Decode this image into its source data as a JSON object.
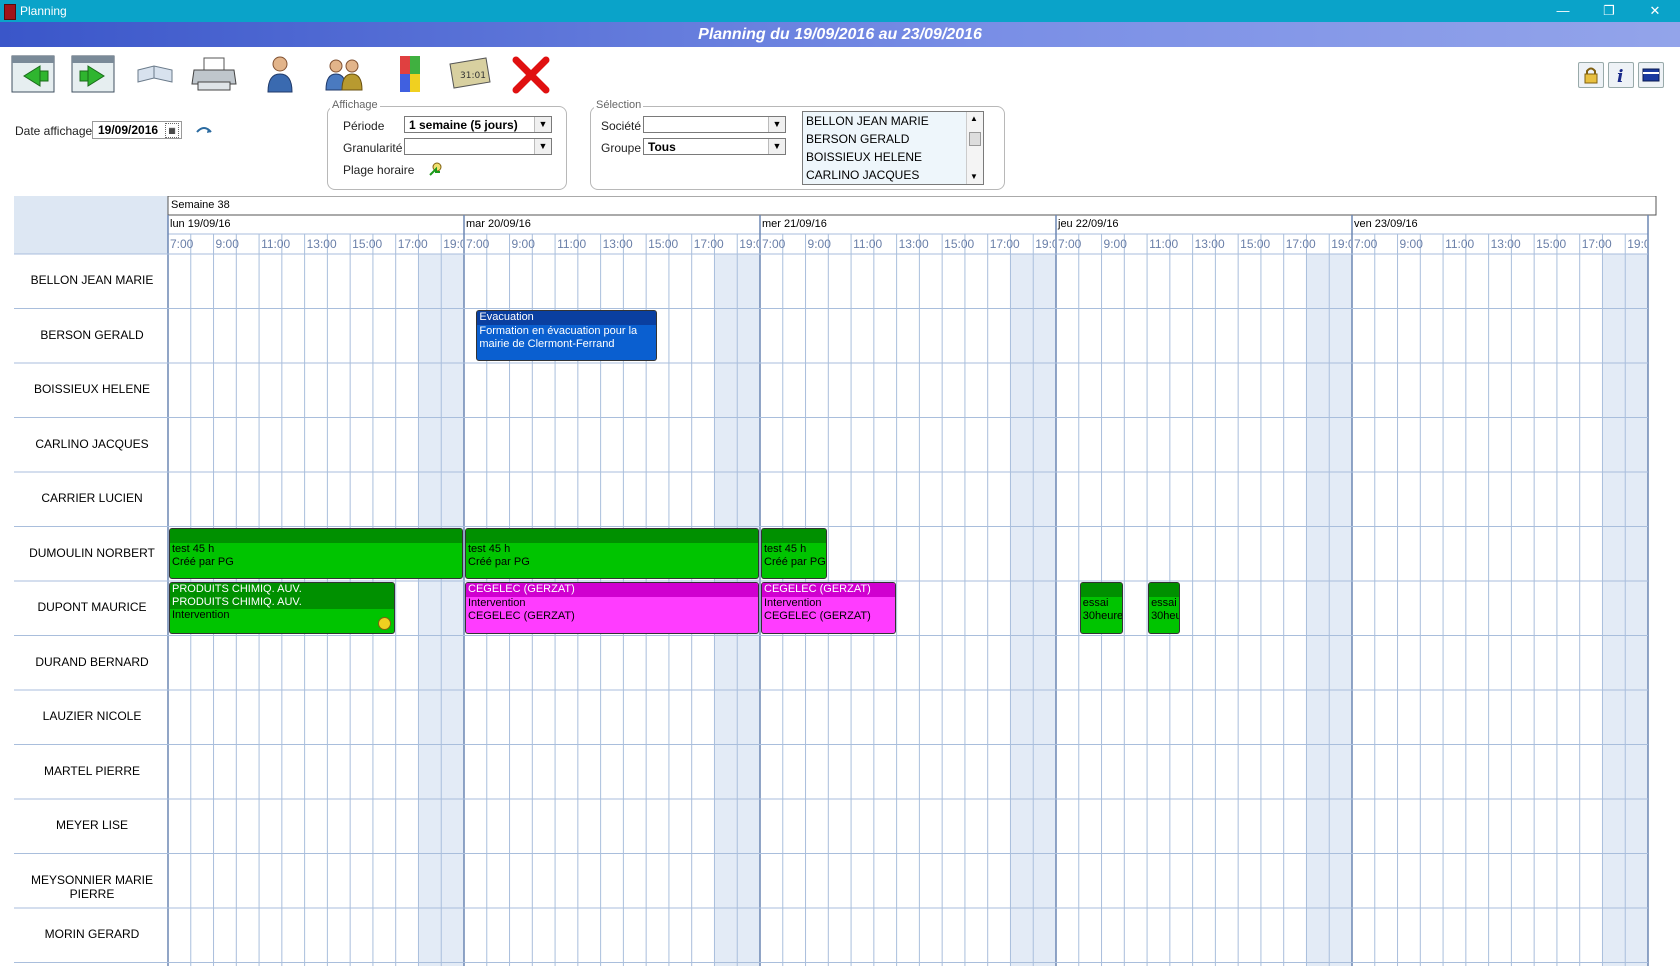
{
  "window": {
    "title": "Planning",
    "minimize": "—",
    "restore": "❐",
    "close": "✕"
  },
  "banner": {
    "title": "Planning du 19/09/2016 au 23/09/2016"
  },
  "toolbar": {
    "icons": [
      "prev-week-icon",
      "next-week-icon",
      "book-icon",
      "printer-icon",
      "person-icon",
      "group-icon",
      "color-icon",
      "calendar-icon",
      "delete-icon"
    ],
    "right_icons": [
      "lock-icon",
      "info-icon",
      "flag-icon"
    ]
  },
  "date_affichage": {
    "label": "Date affichage",
    "value": "19/09/2016"
  },
  "affichage": {
    "legend": "Affichage",
    "periode_label": "Période",
    "periode_value": "1 semaine (5 jours)",
    "granularite_label": "Granularité",
    "granularite_value": "",
    "plage_label": "Plage horaire"
  },
  "selection": {
    "legend": "Sélection",
    "societe_label": "Société",
    "societe_value": "",
    "groupe_label": "Groupe",
    "groupe_value": "Tous",
    "list": [
      "BELLON JEAN MARIE",
      "BERSON GERALD",
      "BOISSIEUX HELENE",
      "CARLINO JACQUES"
    ]
  },
  "planning": {
    "week_label": "Semaine 38",
    "days": [
      "lun 19/09/16",
      "mar 20/09/16",
      "mer 21/09/16",
      "jeu 22/09/16",
      "ven 23/09/16"
    ],
    "hour_labels": [
      "7:00",
      "9:00",
      "11:00",
      "13:00",
      "15:00",
      "17:00",
      "19:00"
    ],
    "rows": [
      "BELLON JEAN MARIE",
      "BERSON GERALD",
      "BOISSIEUX HELENE",
      "CARLINO JACQUES",
      "CARRIER LUCIEN",
      "DUMOULIN NORBERT",
      "DUPONT MAURICE",
      "DURAND BERNARD",
      "LAUZIER NICOLE",
      "MARTEL PIERRE",
      "MEYER LISE",
      "MEYSONNIER MARIE PIERRE",
      "MORIN GERARD"
    ],
    "events": [
      {
        "row": 1,
        "day": 1,
        "start": 7.5,
        "end": 15.5,
        "color": "blue",
        "header": "Evacuation",
        "lines": [
          "Formation en évacuation pour la",
          "mairie de Clermont-Ferrand"
        ]
      },
      {
        "row": 5,
        "day": 0,
        "start": 7.0,
        "end": 20.0,
        "color": "green",
        "header": "",
        "lines": [
          "test 45 h",
          "Créé par PG"
        ]
      },
      {
        "row": 5,
        "day": 1,
        "start": 7.0,
        "end": 20.0,
        "color": "green",
        "header": "",
        "lines": [
          "test 45 h",
          "Créé par PG"
        ]
      },
      {
        "row": 5,
        "day": 2,
        "start": 7.0,
        "end": 10.0,
        "color": "green",
        "header": "",
        "lines": [
          "test 45 h",
          "Créé par PG"
        ]
      },
      {
        "row": 6,
        "day": 0,
        "start": 7.0,
        "end": 17.0,
        "color": "green2",
        "header": "PRODUITS CHIMIQ. AUV.",
        "lines": [
          "PRODUITS CHIMIQ. AUV.",
          "Intervention"
        ]
      },
      {
        "row": 6,
        "day": 1,
        "start": 7.0,
        "end": 20.0,
        "color": "magenta",
        "header": "CEGELEC (GERZAT)",
        "lines": [
          "Intervention",
          "CEGELEC (GERZAT)"
        ]
      },
      {
        "row": 6,
        "day": 2,
        "start": 7.0,
        "end": 13.0,
        "color": "magenta",
        "header": "CEGELEC (GERZAT)",
        "lines": [
          "Intervention",
          "CEGELEC (GERZAT)"
        ]
      },
      {
        "row": 6,
        "day": 3,
        "start": 8.0,
        "end": 10.0,
        "color": "green",
        "header": "",
        "lines": [
          "essai",
          "30heure"
        ]
      },
      {
        "row": 6,
        "day": 3,
        "start": 11.0,
        "end": 12.5,
        "color": "green",
        "header": "",
        "lines": [
          "essai",
          "30heu"
        ]
      }
    ]
  },
  "colors": {
    "grid_line": "#a9bedc",
    "day_line": "#6d87b4",
    "shade": "#e3ebf6",
    "label_col": "#dde7f3"
  }
}
